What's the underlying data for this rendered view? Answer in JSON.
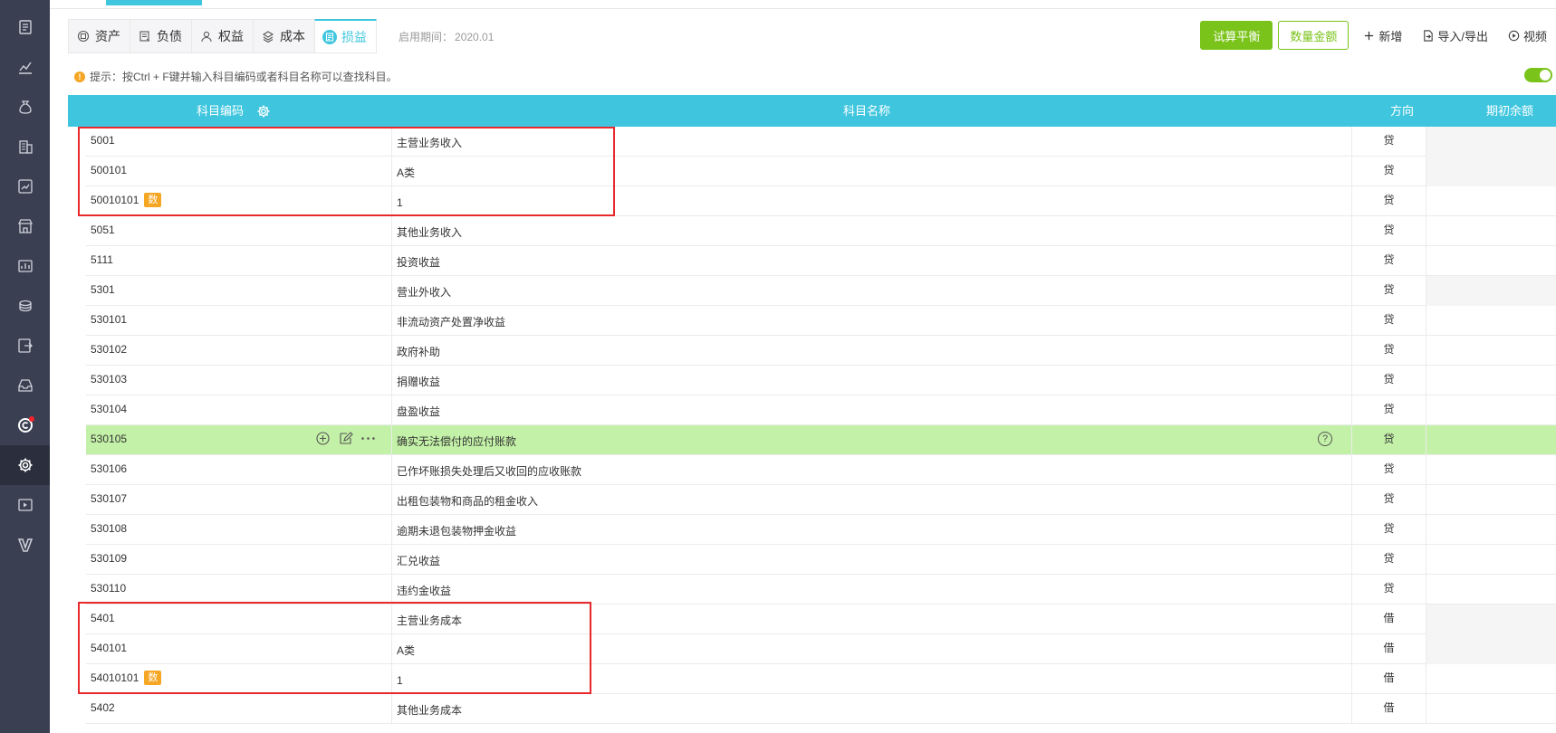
{
  "sidebar": {
    "icons": [
      "ledger-icon",
      "chart-icon",
      "money-bag-icon",
      "building-icon",
      "report-icon",
      "shop-icon",
      "dashboard-icon",
      "stack-coins-icon",
      "export-icon",
      "inbox-icon",
      "copyright-icon",
      "gear-icon",
      "video-icon",
      "v-logo-icon"
    ],
    "active_index": 11,
    "badge_index": 10
  },
  "tabs": [
    {
      "label": "资产",
      "icon": "asset-icon"
    },
    {
      "label": "负债",
      "icon": "liability-icon"
    },
    {
      "label": "权益",
      "icon": "equity-icon"
    },
    {
      "label": "成本",
      "icon": "layers-icon"
    },
    {
      "label": "损益",
      "icon": "profit-loss-icon",
      "active": true
    }
  ],
  "period": {
    "label": "启用期间：",
    "value": "2020.01"
  },
  "toolbar": {
    "trial_balance": "试算平衡",
    "quantity_amount": "数量金额",
    "add": "新增",
    "import_export": "导入/导出",
    "video": "视频"
  },
  "tip": "提示：按Ctrl + F键并输入科目编码或者科目名称可以查找科目。",
  "table": {
    "headers": {
      "code": "科目编码",
      "name": "科目名称",
      "direction": "方向",
      "opening_balance": "期初余额"
    },
    "rows": [
      {
        "code": "5001",
        "name": "主营业务收入",
        "dir": "贷",
        "gray": true
      },
      {
        "code": "500101",
        "name": "A类",
        "dir": "贷",
        "gray": true
      },
      {
        "code": "50010101",
        "badge": "数",
        "name": "1",
        "dir": "贷"
      },
      {
        "code": "5051",
        "name": "其他业务收入",
        "dir": "贷"
      },
      {
        "code": "5111",
        "name": "投资收益",
        "dir": "贷"
      },
      {
        "code": "5301",
        "name": "营业外收入",
        "dir": "贷",
        "gray": true
      },
      {
        "code": "530101",
        "name": "非流动资产处置净收益",
        "dir": "贷"
      },
      {
        "code": "530102",
        "name": "政府补助",
        "dir": "贷"
      },
      {
        "code": "530103",
        "name": "捐赠收益",
        "dir": "贷"
      },
      {
        "code": "530104",
        "name": "盘盈收益",
        "dir": "贷"
      },
      {
        "code": "530105",
        "name": "确实无法偿付的应付账款",
        "dir": "贷",
        "highlight": true
      },
      {
        "code": "530106",
        "name": "已作坏账损失处理后又收回的应收账款",
        "dir": "贷"
      },
      {
        "code": "530107",
        "name": "出租包装物和商品的租金收入",
        "dir": "贷"
      },
      {
        "code": "530108",
        "name": "逾期未退包装物押金收益",
        "dir": "贷"
      },
      {
        "code": "530109",
        "name": "汇兑收益",
        "dir": "贷"
      },
      {
        "code": "530110",
        "name": "违约金收益",
        "dir": "贷"
      },
      {
        "code": "5401",
        "name": "主营业务成本",
        "dir": "借",
        "gray": true
      },
      {
        "code": "540101",
        "name": "A类",
        "dir": "借",
        "gray": true
      },
      {
        "code": "54010101",
        "badge": "数",
        "name": "1",
        "dir": "借"
      },
      {
        "code": "5402",
        "name": "其他业务成本",
        "dir": "借"
      }
    ]
  },
  "colors": {
    "accent": "#3fc6de",
    "primary_green": "#7ac31a",
    "highlight_row": "#c3f1a7",
    "annotation_red": "#e8282b",
    "sidebar": "#3a3f51"
  }
}
